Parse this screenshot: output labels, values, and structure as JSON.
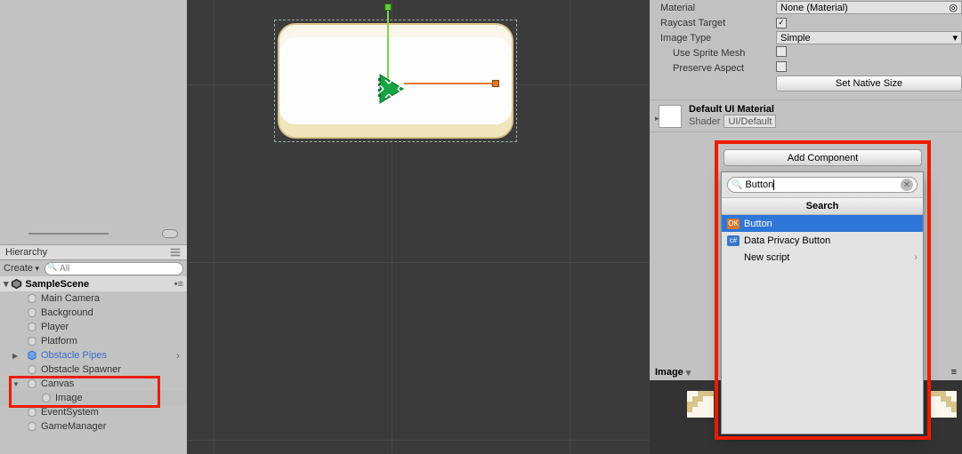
{
  "hierarchy": {
    "panel_title": "Hierarchy",
    "create_label": "Create",
    "search_placeholder": "All",
    "scene_name": "SampleScene",
    "items": [
      {
        "label": "Main Camera"
      },
      {
        "label": "Background"
      },
      {
        "label": "Player"
      },
      {
        "label": "Platform"
      },
      {
        "label": "Obstacle Pipes"
      },
      {
        "label": "Obstacle Spawner"
      },
      {
        "label": "Canvas"
      },
      {
        "label": "Image"
      },
      {
        "label": "EventSystem"
      },
      {
        "label": "GameManager"
      }
    ]
  },
  "inspector": {
    "material_label": "Material",
    "material_value": "None (Material)",
    "raycast_label": "Raycast Target",
    "raycast_checked": true,
    "image_type_label": "Image Type",
    "image_type_value": "Simple",
    "use_sprite_mesh_label": "Use Sprite Mesh",
    "use_sprite_mesh_checked": false,
    "preserve_aspect_label": "Preserve Aspect",
    "preserve_aspect_checked": false,
    "set_native_size_label": "Set Native Size",
    "default_material_title": "Default UI Material",
    "shader_label": "Shader",
    "shader_value": "UI/Default",
    "add_component_label": "Add Component",
    "preview_title": "Image"
  },
  "popup": {
    "search_value": "Button",
    "header": "Search",
    "items": [
      {
        "label": "Button",
        "badge": "orange"
      },
      {
        "label": "Data Privacy Button",
        "badge": "blue"
      },
      {
        "label": "New script",
        "badge": "",
        "has_arrow": true
      }
    ]
  },
  "icons": {
    "search": "🔍",
    "close": "✕",
    "arrow_right": "›"
  }
}
